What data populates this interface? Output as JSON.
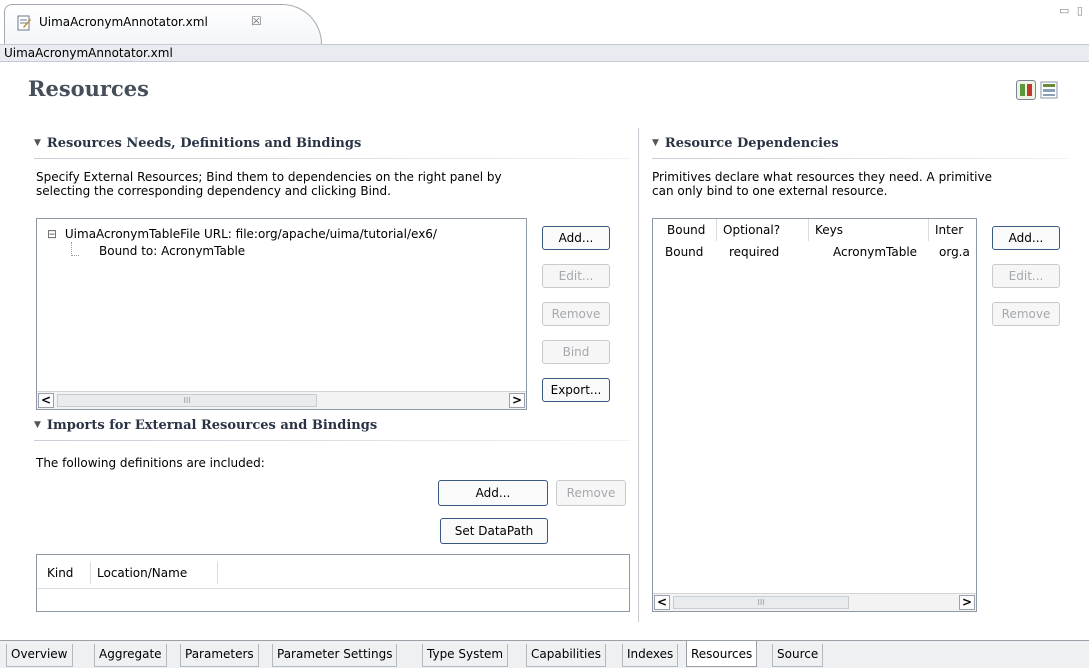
{
  "editor": {
    "tab_title": "UimaAcronymAnnotator.xml",
    "tab_close": "☒",
    "breadcrumb": "UimaAcronymAnnotator.xml"
  },
  "page": {
    "title": "Resources"
  },
  "left_section": {
    "title": "Resources Needs, Definitions and Bindings",
    "description_line1": "Specify External Resources; Bind them to dependencies on the right panel by",
    "description_line2": "selecting the corresponding dependency and clicking Bind.",
    "tree": {
      "expander": "⊟",
      "node_label": "UimaAcronymTableFile  URL: file:org/apache/uima/tutorial/ex6/",
      "child_label": "Bound to: AcronymTable"
    },
    "buttons": {
      "add": "Add...",
      "edit": "Edit...",
      "remove": "Remove",
      "bind": "Bind",
      "export": "Export..."
    }
  },
  "imports_section": {
    "title": "Imports for External Resources and Bindings",
    "description": "The following definitions are included:",
    "buttons": {
      "add": "Add...",
      "remove": "Remove",
      "set_datapath": "Set DataPath"
    },
    "table_columns": [
      "Kind",
      "Location/Name"
    ]
  },
  "right_section": {
    "title": "Resource Dependencies",
    "description_line1": "Primitives declare what resources they need. A primitive",
    "description_line2": "can only bind to one external resource.",
    "columns": [
      "Bound",
      "Optional?",
      "Keys",
      "Inter"
    ],
    "rows": [
      {
        "bound": "Bound",
        "optional": "required",
        "keys": "AcronymTable",
        "inter": "org.a"
      }
    ],
    "buttons": {
      "add": "Add...",
      "edit": "Edit...",
      "remove": "Remove"
    }
  },
  "scroll_arrows": {
    "left": "<",
    "right": ">",
    "thumb": "III"
  },
  "page_tabs": [
    {
      "label": "Overview",
      "active": false
    },
    {
      "label": "Aggregate",
      "active": false
    },
    {
      "label": "Parameters",
      "active": false
    },
    {
      "label": "Parameter Settings",
      "active": false
    },
    {
      "label": "Type System",
      "active": false
    },
    {
      "label": "Capabilities",
      "active": false
    },
    {
      "label": "Indexes",
      "active": false
    },
    {
      "label": "Resources",
      "active": true
    },
    {
      "label": "Source",
      "active": false
    }
  ],
  "colors": {
    "title_text": "#464e5a",
    "section_text": "#2a3344",
    "button_border": "#3a5682",
    "disabled_text": "#a5a9ae"
  }
}
